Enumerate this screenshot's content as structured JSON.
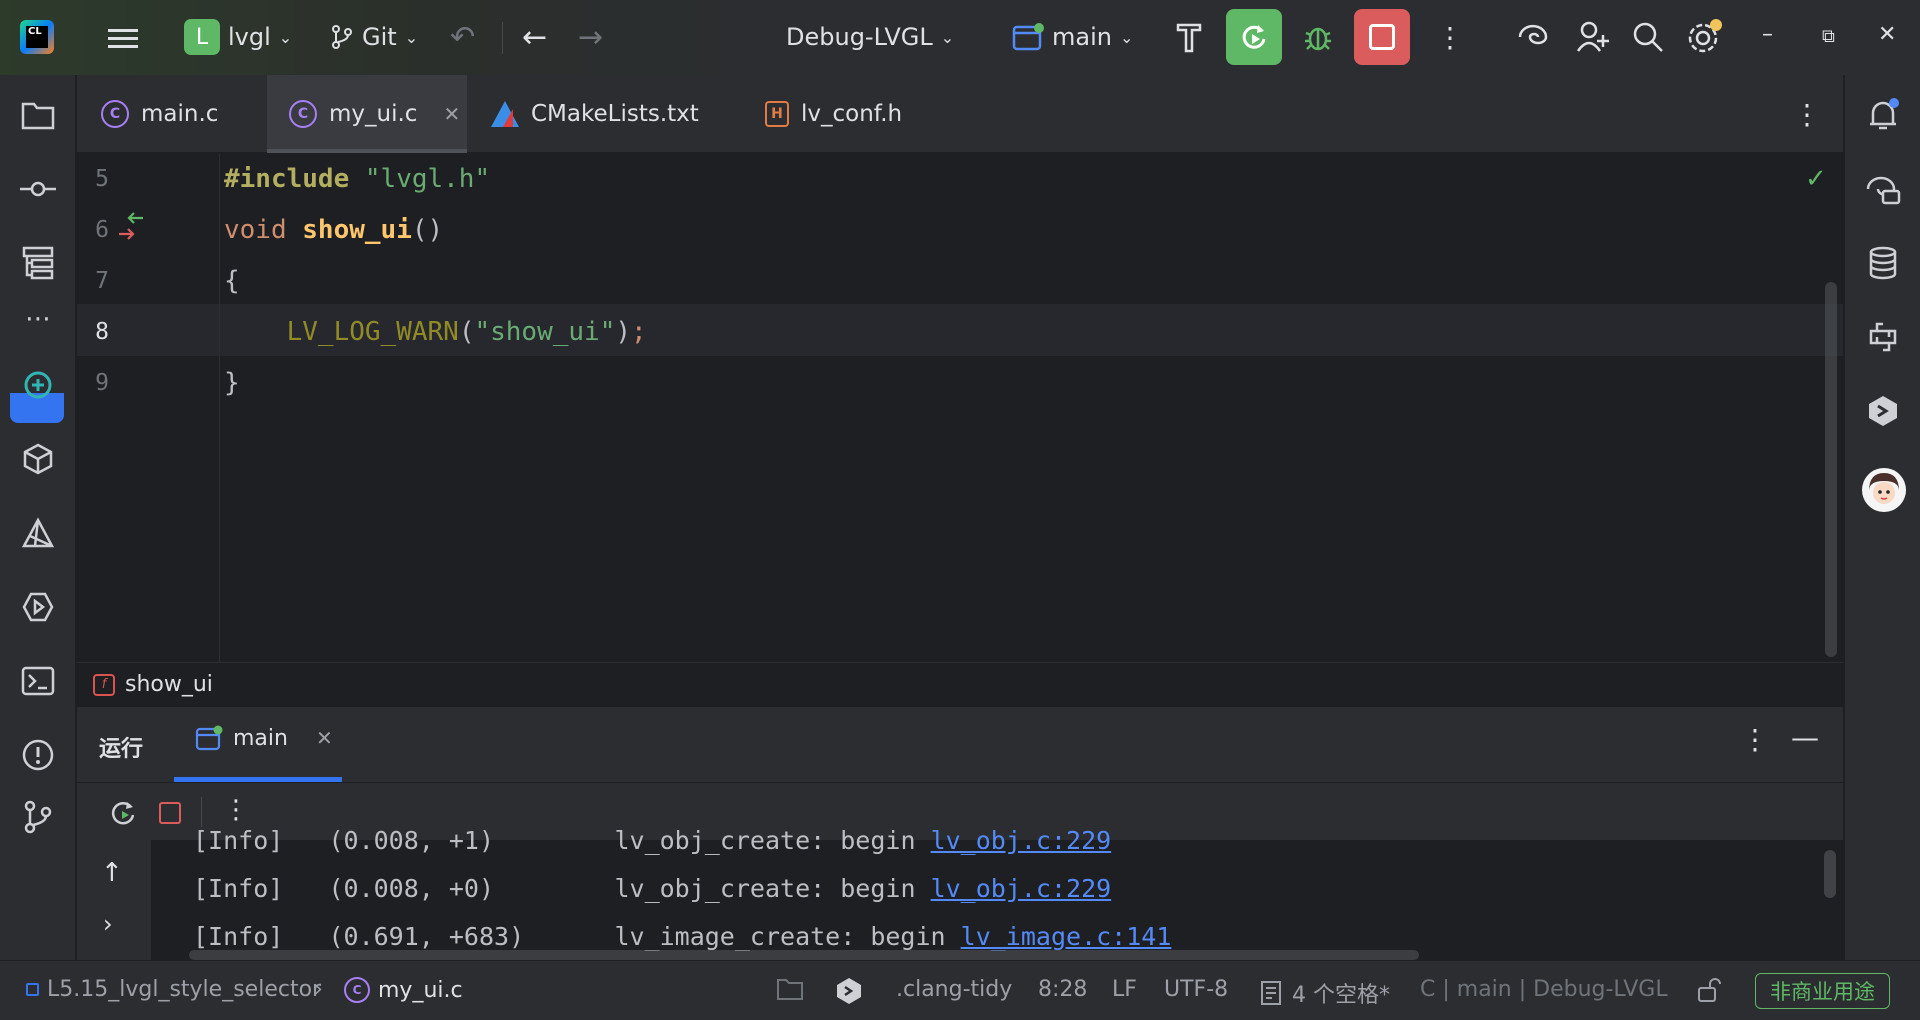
{
  "titlebar": {
    "project_badge": "L",
    "project_name": "lvgl",
    "vcs_label": "Git",
    "run_config": "Debug-LVGL",
    "target": "main"
  },
  "tabs": [
    {
      "label": "main.c",
      "icon": "c-file-icon"
    },
    {
      "label": "my_ui.c",
      "icon": "c-file-icon",
      "active": true
    },
    {
      "label": "CMakeLists.txt",
      "icon": "cmake-icon"
    },
    {
      "label": "lv_conf.h",
      "icon": "h-file-icon"
    }
  ],
  "editor": {
    "lines": [
      {
        "no": "5",
        "parts": [
          "#include",
          " ",
          "\"lvgl.h\""
        ]
      },
      {
        "no": "6",
        "parts": [
          "void",
          " ",
          "show_ui",
          "()"
        ]
      },
      {
        "no": "7",
        "parts": [
          "{"
        ]
      },
      {
        "no": "8",
        "parts": [
          "    ",
          "LV_LOG_WARN",
          "(",
          "\"show_ui\"",
          ")",
          ";"
        ]
      },
      {
        "no": "9",
        "parts": [
          "}"
        ]
      }
    ],
    "current_line": "8"
  },
  "breadcrumb": {
    "function": "show_ui"
  },
  "run_window": {
    "title": "运行",
    "tab_label": "main",
    "log": [
      {
        "level": "[Info]",
        "time": "(0.008, +1)",
        "msg": "lv_obj_create: begin",
        "link": "lv_obj.c:229"
      },
      {
        "level": "[Info]",
        "time": "(0.008, +0)",
        "msg": "lv_obj_create: begin",
        "link": "lv_obj.c:229"
      },
      {
        "level": "[Info]",
        "time": "(0.691, +683)",
        "msg": "lv_image_create: begin",
        "link": "lv_image.c:141"
      }
    ]
  },
  "statusbar": {
    "project_path": "L5.15_lvgl_style_selector",
    "file": "my_ui.c",
    "inspector": ".clang-tidy",
    "position": "8:28",
    "line_sep": "LF",
    "encoding": "UTF-8",
    "indent": "4 个空格*",
    "context": "C | main | Debug-LVGL",
    "license": "非商业用途"
  },
  "colors": {
    "accent": "#3574f0",
    "run_green": "#5fb865",
    "stop_red": "#db5c5c"
  }
}
